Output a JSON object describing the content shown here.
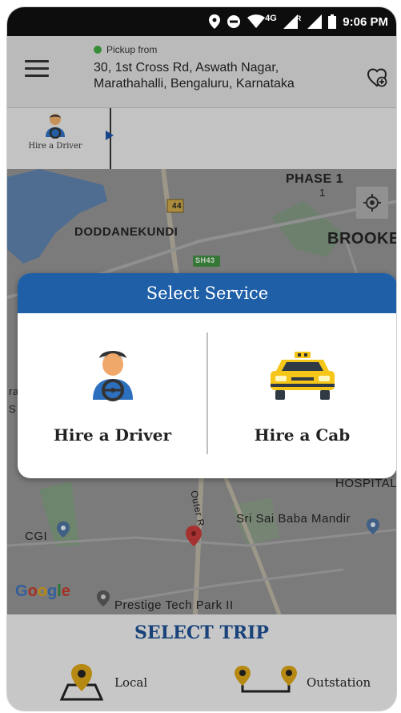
{
  "status_bar": {
    "network": "4G",
    "roaming": "R",
    "time": "9:06 PM"
  },
  "header": {
    "pickup_label": "Pickup from",
    "pickup_address": "30, 1st Cross Rd, Aswath Nagar, Marathahalli, Bengaluru, Karnataka"
  },
  "service_strip": {
    "tab_label": "Hire a Driver"
  },
  "map": {
    "labels": {
      "phase": "PHASE 1",
      "phase_num": "1",
      "doddanekundi": "DODDANEKUNDI",
      "brooke": "BROOKE",
      "highway_44": "44",
      "road_sh": "SH43",
      "hospital": "HOSPITALS",
      "outer_road": "Outer R",
      "sri_sai": "Sri Sai Baba Mandir",
      "cgi": "CGI",
      "prestige": "Prestige Tech Park II",
      "left_edge_1": "ra",
      "left_edge_2": "S"
    },
    "google": [
      "G",
      "o",
      "o",
      "g",
      "l",
      "e"
    ]
  },
  "modal": {
    "title": "Select Service",
    "options": [
      {
        "label": "Hire a Driver",
        "icon": "driver-icon"
      },
      {
        "label": "Hire a Cab",
        "icon": "taxi-icon"
      }
    ]
  },
  "bottom": {
    "title": "SELECT TRIP",
    "options": [
      {
        "label": "Local",
        "icon": "map-pin-icon"
      },
      {
        "label": "Outstation",
        "icon": "route-icon"
      }
    ]
  },
  "colors": {
    "primary": "#1e5fa8",
    "trip_title": "#1e4f8f",
    "pin_gold": "#d4a017",
    "taxi_yellow": "#f5c518"
  }
}
